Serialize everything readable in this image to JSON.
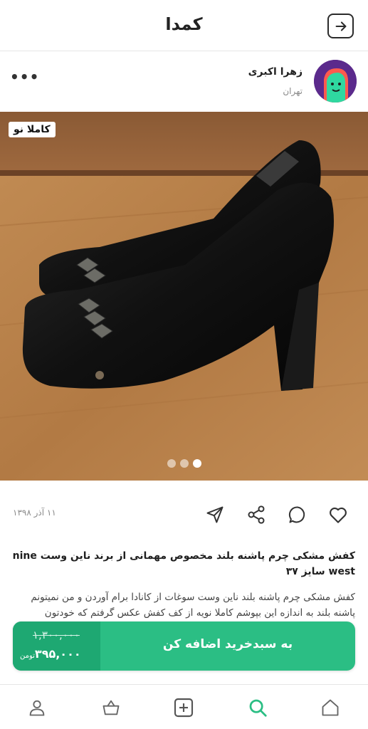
{
  "app": {
    "title": "کمدا"
  },
  "seller": {
    "name": "زهرا اکبری",
    "city": "تهران"
  },
  "product": {
    "condition_badge": "کاملا نو",
    "image_count": 3,
    "active_image": 1,
    "date": "۱۱ آذر ۱۳۹۸",
    "title": "کفش مشکی چرم  پاشنه بلند مخصوص مهمانی از برند ناین وست nine west سایز ۳۷",
    "description": "کفش مشکی چرم پاشنه بلند ناین وست سوغات از کانادا برام آوردن و من نمیتونم پاشنه بلند به اندازه این بپوشم کاملا نویه از کف کفش عکس گرفتم که خودتون"
  },
  "buy": {
    "old_price": "۱,۳۰۰,۰۰۰",
    "new_price": "۳۹۵,۰۰۰",
    "currency": "تومن",
    "button_label": "به سبدخرید اضافه کن"
  },
  "icons": {
    "back": "arrow-right-box-icon",
    "more": "more-horizontal-icon",
    "like": "heart-icon",
    "comment": "comment-icon",
    "share": "share-icon",
    "send": "send-icon",
    "nav": [
      "home-icon",
      "search-icon",
      "plus-box-icon",
      "basket-icon",
      "profile-icon"
    ]
  },
  "colors": {
    "accent": "#2bbe84",
    "accent_dark": "#1ea872",
    "active_nav": "#2bbe84"
  }
}
